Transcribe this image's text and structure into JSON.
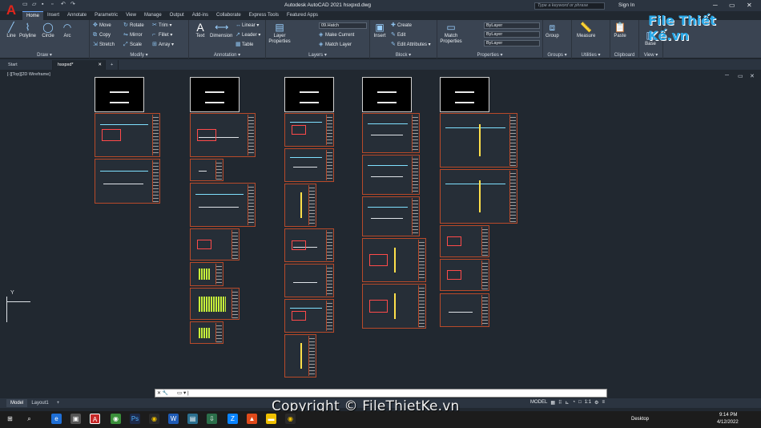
{
  "app": {
    "logo_letter": "A",
    "window_title": "Autodesk AutoCAD 2021    hsxpxd.dwg",
    "search_placeholder": "Type a keyword or phrase",
    "signin": "Sign In"
  },
  "ribbon_tabs": [
    "Home",
    "Insert",
    "Annotate",
    "Parametric",
    "View",
    "Manage",
    "Output",
    "Add-ins",
    "Collaborate",
    "Express Tools",
    "Featured Apps"
  ],
  "ribbon": {
    "draw": {
      "label": "Draw ▾",
      "line": "Line",
      "polyline": "Polyline",
      "circle": "Circle",
      "arc": "Arc"
    },
    "modify": {
      "label": "Modify ▾",
      "move": "Move",
      "rotate": "Rotate",
      "trim": "Trim ▾",
      "copy": "Copy",
      "mirror": "Mirror",
      "fillet": "Fillet ▾",
      "stretch": "Stretch",
      "scale": "Scale",
      "array": "Array ▾"
    },
    "annotation": {
      "label": "Annotation ▾",
      "text": "Text",
      "dimension": "Dimension",
      "linear": "Linear ▾",
      "leader": "Leader ▾",
      "table": "Table"
    },
    "layers": {
      "label": "Layers ▾",
      "layer_properties": "Layer Properties",
      "layer_combo": "09.Hatch",
      "make_current": "Make Current",
      "match_layer": "Match Layer"
    },
    "block": {
      "label": "Block ▾",
      "insert": "Insert",
      "create": "Create",
      "edit": "Edit",
      "edit_attributes": "Edit Attributes ▾"
    },
    "properties": {
      "label": "Properties ▾",
      "match_properties": "Match Properties",
      "color": "ByLayer",
      "linetype": "ByLayer",
      "lineweight": "ByLayer"
    },
    "groups": {
      "label": "Groups ▾",
      "group": "Group"
    },
    "utilities": {
      "label": "Utilities ▾",
      "measure": "Measure"
    },
    "clipboard": {
      "label": "Clipboard",
      "paste": "Paste"
    },
    "view": {
      "label": "View ▾",
      "base": "Base"
    }
  },
  "doc_tabs": [
    "Start",
    "hsxpxd*"
  ],
  "viewport": {
    "label": "[-][Top][2D Wireframe]"
  },
  "ucs": {
    "y": "Y"
  },
  "command": {
    "prompt": "▭ ▾ |"
  },
  "layout_tabs": [
    "Model",
    "Layout1",
    "+"
  ],
  "status": {
    "model": "MODEL",
    "scale": "1:1"
  },
  "watermark": "Copyright © FileThietKe.vn",
  "logo_watermark": "File Thiết Kế.vn",
  "taskbar": {
    "desktop": "Desktop",
    "time": "9:14 PM",
    "date": "4/12/2022"
  }
}
